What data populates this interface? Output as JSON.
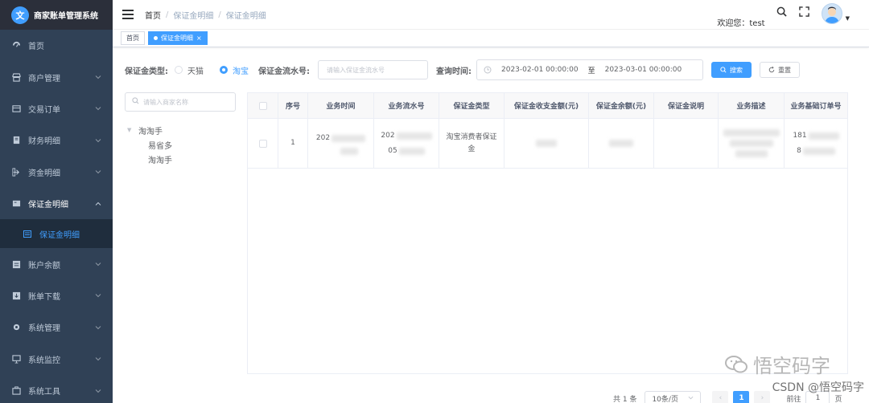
{
  "app": {
    "title": "商家账单管理系统",
    "logo_text": "文"
  },
  "sidebar": {
    "items": [
      {
        "label": "首页",
        "icon": "dashboard-icon",
        "has_children": false
      },
      {
        "label": "商户管理",
        "icon": "merchant-icon",
        "has_children": true
      },
      {
        "label": "交易订单",
        "icon": "order-icon",
        "has_children": true
      },
      {
        "label": "财务明细",
        "icon": "finance-icon",
        "has_children": true
      },
      {
        "label": "资金明细",
        "icon": "funds-icon",
        "has_children": true
      },
      {
        "label": "保证金明细",
        "icon": "deposit-icon",
        "has_children": true,
        "open": true
      },
      {
        "label": "账户余额",
        "icon": "balance-icon",
        "has_children": true
      },
      {
        "label": "账单下载",
        "icon": "download-icon",
        "has_children": true
      },
      {
        "label": "系统管理",
        "icon": "settings-icon",
        "has_children": true
      },
      {
        "label": "系统监控",
        "icon": "monitor-icon",
        "has_children": true
      },
      {
        "label": "系统工具",
        "icon": "tools-icon",
        "has_children": true
      }
    ],
    "active_sub": "保证金明细"
  },
  "header": {
    "breadcrumb": [
      "首页",
      "保证金明细",
      "保证金明细"
    ],
    "welcome": "欢迎您：test"
  },
  "tags": {
    "home": "首页",
    "active": "保证金明细",
    "close": "×"
  },
  "filters": {
    "type_label": "保证金类型:",
    "type_options": [
      "天猫",
      "淘宝"
    ],
    "type_selected": "淘宝",
    "flow_label": "保证金流水号:",
    "flow_placeholder": "请输入保证金流水号",
    "time_label": "查询时间:",
    "start_time": "2023-02-01 00:00:00",
    "range_sep": "至",
    "end_time": "2023-03-01 00:00:00",
    "search_btn": "搜索",
    "reset_btn": "重置"
  },
  "tree": {
    "search_placeholder": "请输入商家名称",
    "root": "淘淘手",
    "children": [
      "易省多",
      "淘淘手"
    ]
  },
  "table": {
    "columns": [
      "序号",
      "业务时间",
      "业务流水号",
      "保证金类型",
      "保证金收支金额(元)",
      "保证金余额(元)",
      "保证金说明",
      "业务描述",
      "业务基础订单号"
    ],
    "rows": [
      {
        "index": "1",
        "time_prefix": "202",
        "flow_prefix_1": "202",
        "flow_prefix_2": "05",
        "type": "淘宝消费者保证金",
        "order_prefix_1": "181",
        "order_prefix_2": "8"
      }
    ]
  },
  "pagination": {
    "total": "共 1 条",
    "page_size": "10条/页",
    "current": "1",
    "goto_label": "前往",
    "goto_value": "1",
    "goto_suffix": "页"
  },
  "watermark": {
    "text": "悟空码字",
    "csdn": "CSDN @悟空码字"
  },
  "colors": {
    "primary": "#409eff",
    "sidebar_bg": "#304156",
    "sidebar_logo_bg": "#2b2f3a",
    "submenu_bg": "#1f2d3d"
  }
}
